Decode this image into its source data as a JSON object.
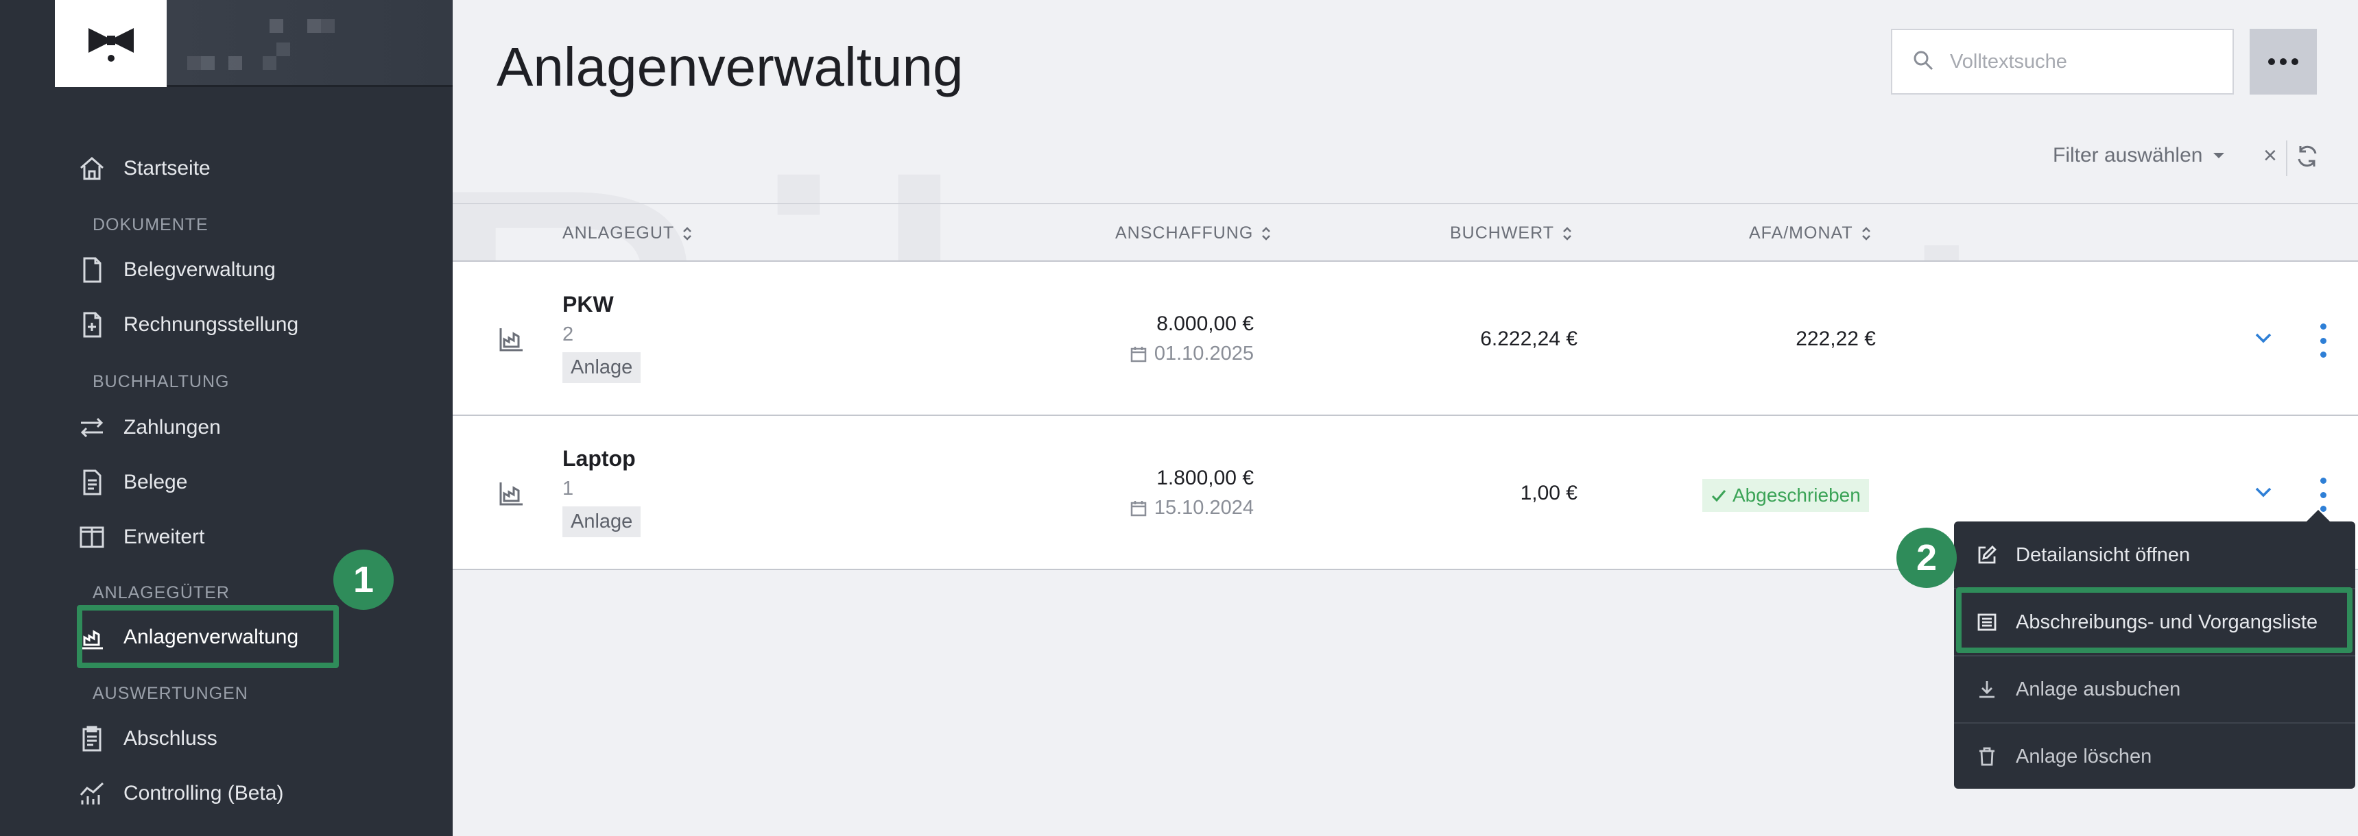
{
  "sidebar": {
    "items": [
      {
        "label": "Startseite"
      },
      {
        "label": "Belegverwaltung"
      },
      {
        "label": "Rechnungsstellung"
      },
      {
        "label": "Zahlungen"
      },
      {
        "label": "Belege"
      },
      {
        "label": "Erweitert"
      },
      {
        "label": "Anlagenverwaltung"
      },
      {
        "label": "Abschluss"
      },
      {
        "label": "Controlling (Beta)"
      }
    ],
    "sections": [
      "DOKUMENTE",
      "BUCHHALTUNG",
      "ANLAGEGÜTER",
      "AUSWERTUNGEN"
    ]
  },
  "header": {
    "title": "Anlagenverwaltung",
    "search_placeholder": "Volltextsuche",
    "filter_label": "Filter auswählen",
    "filter_clear": "×"
  },
  "table": {
    "columns": [
      "ANLAGEGUT",
      "ANSCHAFFUNG",
      "BUCHWERT",
      "AFA/MONAT"
    ],
    "rows": [
      {
        "name": "PKW",
        "number": "2",
        "tag": "Anlage",
        "cost": "8.000,00 €",
        "date": "01.10.2025",
        "book_value": "6.222,24 €",
        "afa": "222,22 €"
      },
      {
        "name": "Laptop",
        "number": "1",
        "tag": "Anlage",
        "cost": "1.800,00 €",
        "date": "15.10.2024",
        "book_value": "1,00 €",
        "status": "Abgeschrieben"
      }
    ]
  },
  "menu": {
    "items": [
      {
        "label": "Detailansicht öffnen"
      },
      {
        "label": "Abschreibungs- und Vorgangsliste"
      },
      {
        "label": "Anlage ausbuchen"
      },
      {
        "label": "Anlage löschen"
      }
    ]
  },
  "annotations": {
    "step1": "1",
    "step2": "2"
  },
  "colors": {
    "sidebar_bg": "#2b3039",
    "accent_green": "#2f8c5a",
    "link_blue": "#2e7fd6",
    "status_green": "#3aa356"
  }
}
